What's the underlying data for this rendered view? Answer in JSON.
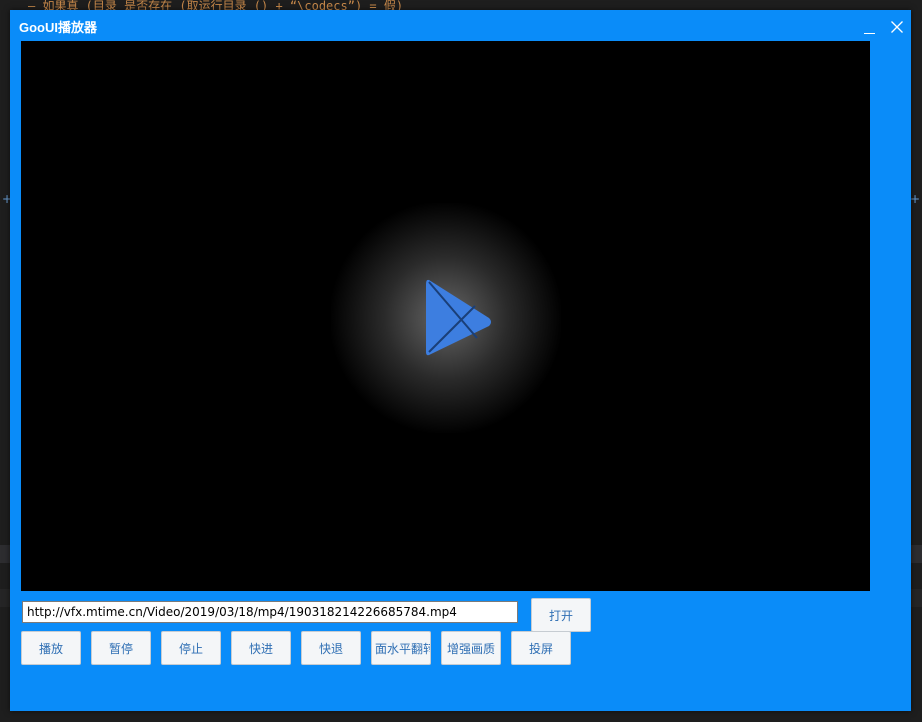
{
  "background": {
    "code_line": "— 如果真 (目录_是否存在 (取运行目录 () + “\\codecs”) = 假)"
  },
  "window": {
    "title": "GooUI播放器",
    "minimize_icon": "minimize-icon",
    "close_icon": "close-icon"
  },
  "video": {
    "logo_icon": "play-logo-icon",
    "logo_color": "#3d7ee0"
  },
  "url_field": {
    "value": "http://vfx.mtime.cn/Video/2019/03/18/mp4/190318214226685784.mp4"
  },
  "buttons": {
    "open": "打开",
    "play": "播放",
    "pause": "暂停",
    "stop": "停止",
    "fast_forward": "快进",
    "rewind": "快退",
    "flip_horizontal": "面水平翻转",
    "enhance_quality": "增强画质",
    "cast_screen": "投屏"
  },
  "colors": {
    "window_bg": "#0a8cf9",
    "button_text": "#2f6fb4"
  }
}
